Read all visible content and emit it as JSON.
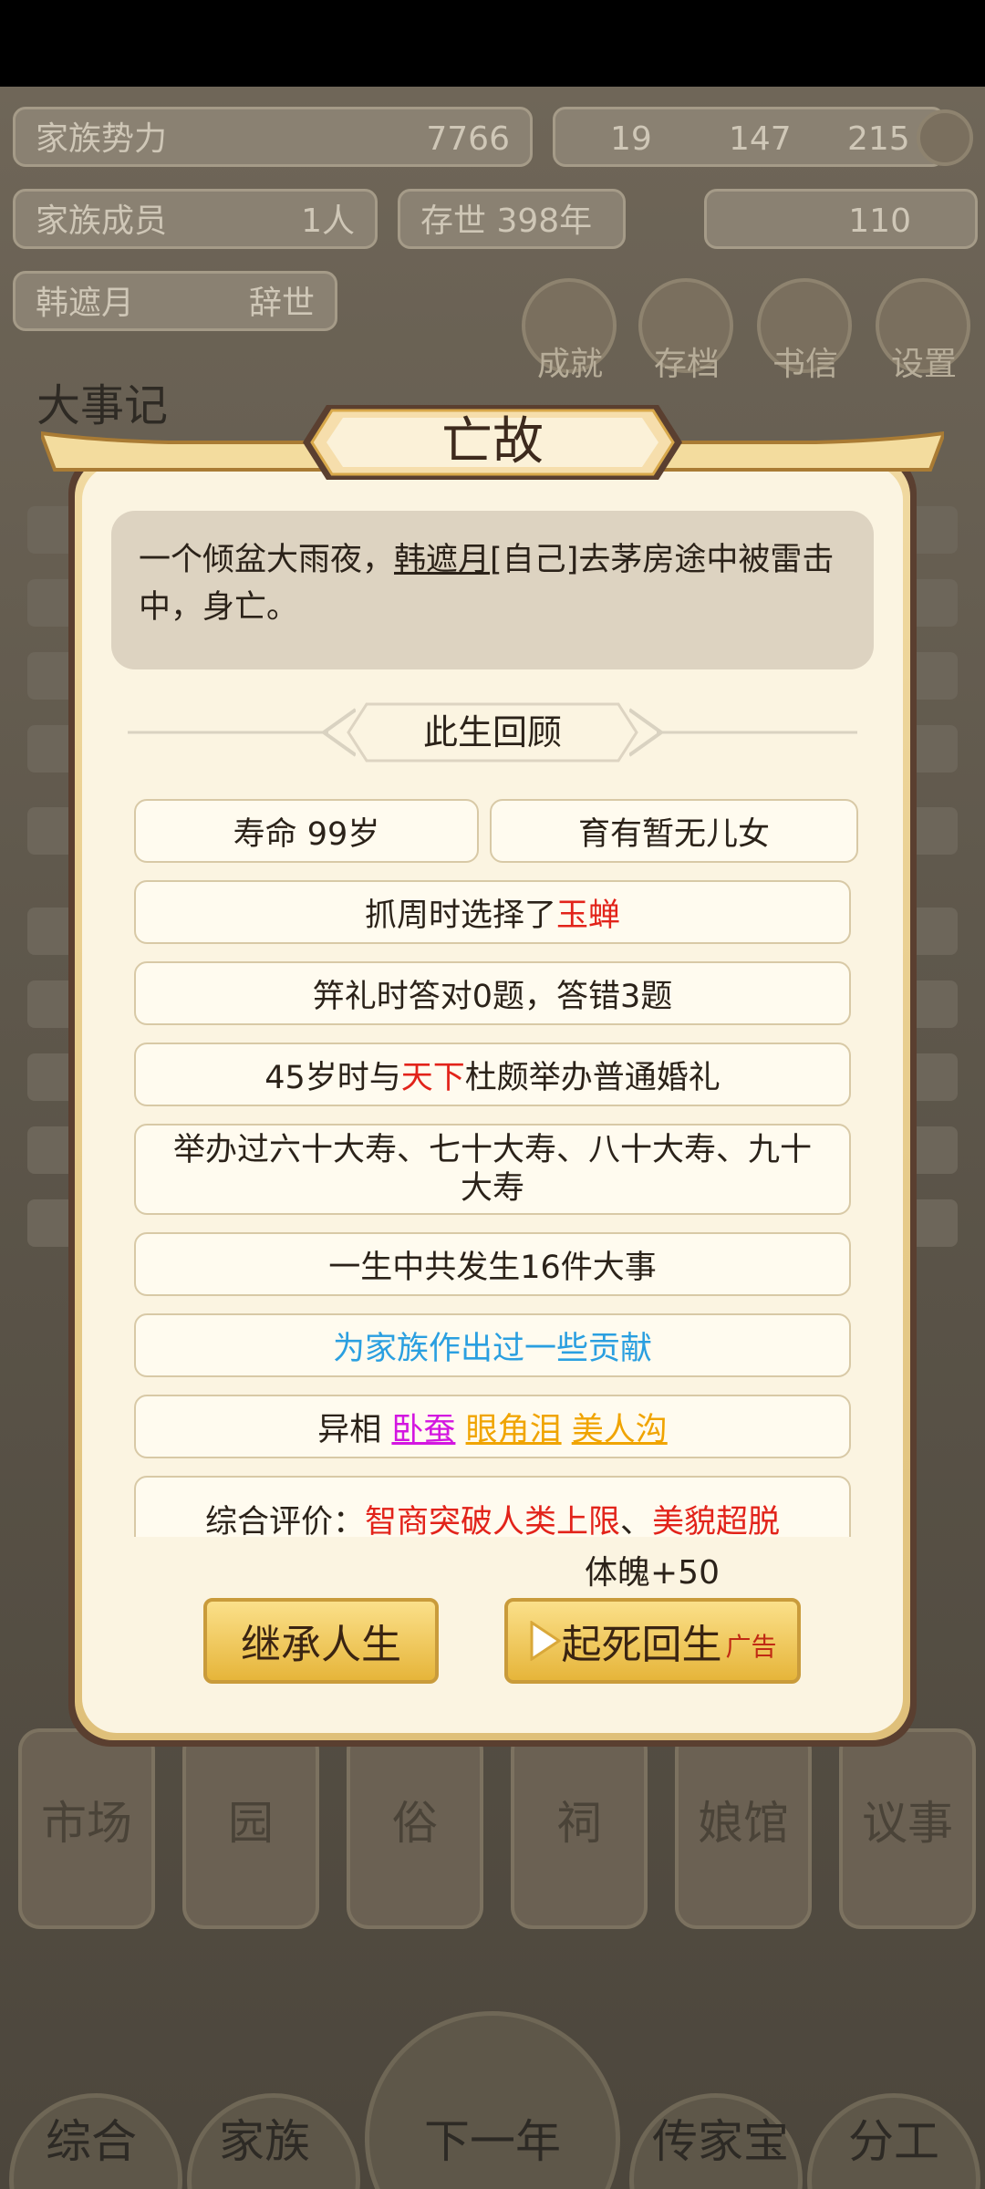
{
  "status": {
    "family_power_label": "家族势力",
    "family_power_value": "7766",
    "family_members_label": "家族成员",
    "family_members_value": "1人",
    "existence": "存世 398年",
    "person_name": "韩遮月",
    "person_status": "辞世",
    "res_a": "19",
    "res_b": "147",
    "res_c": "215",
    "gold": "110"
  },
  "menu": [
    "成就",
    "存档",
    "书信",
    "设置"
  ],
  "events_header": "大事记",
  "buildings": [
    "市场",
    "园",
    "俗",
    "祠",
    "娘馆",
    "议事"
  ],
  "nav": [
    "综合",
    "家族",
    "下一年",
    "传家宝",
    "分工"
  ],
  "dialog": {
    "title": "亡故",
    "desc_before": "一个倾盆大雨夜，",
    "desc_name": "韩遮月",
    "desc_after": "[自己]去茅房途中被雷击中，身亡。",
    "section_title": "此生回顾",
    "lifespan": "寿命 99岁",
    "children": "育有暂无儿女",
    "zhuazhou_before": "抓周时选择了",
    "zhuazhou_item": "玉蝉",
    "quiz": "笄礼时答对0题，答错3题",
    "wedding_age": "45岁时与",
    "wedding_place": "天下",
    "wedding_after": "杜颇举办普通婚礼",
    "birthdays": "举办过六十大寿、七十大寿、八十大寿、九十大寿",
    "events": "一生中共发生16件大事",
    "contribution": "为家族作出过一些贡献",
    "traits_label": "异相",
    "trait_1": "卧蚕",
    "trait_2": "眼角泪",
    "trait_3": "美人沟",
    "eval_label": "综合评价：",
    "eval_1": "智商突破人类上限",
    "eval_sep": "、",
    "eval_2": "美貌超脱",
    "bonus": "体魄+50",
    "inherit_button": "继承人生",
    "revive_button": "起死回生",
    "ad_tag": "广告"
  },
  "colors": {
    "accent_red": "#e2231a",
    "accent_blue": "#2a9fe0",
    "accent_magenta": "#d316e0",
    "accent_orange": "#f0a400",
    "button_gold": "#e6b53a"
  }
}
